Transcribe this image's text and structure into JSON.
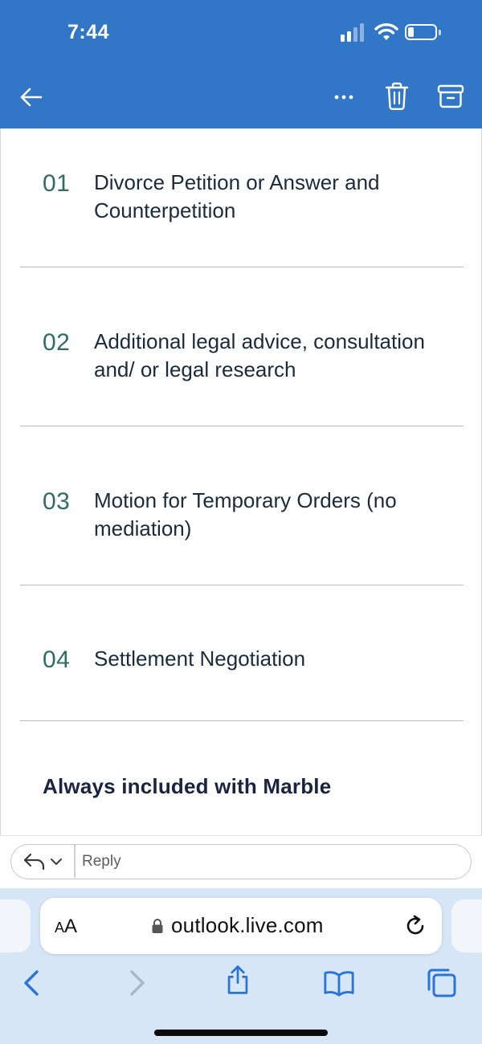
{
  "status_bar": {
    "time": "7:44"
  },
  "toolbar": {
    "back_icon": "back-arrow-icon",
    "more_icon": "more-horizontal-icon",
    "delete_icon": "trash-icon",
    "archive_icon": "archive-icon",
    "header_color": "#3276c8"
  },
  "services": [
    {
      "number": "01",
      "title": "Divorce Petition or Answer and Counterpetition"
    },
    {
      "number": "02",
      "title": "Additional legal advice, consultation and/ or legal research"
    },
    {
      "number": "03",
      "title": "Motion for Temporary Orders (no mediation)"
    },
    {
      "number": "04",
      "title": "Settlement Negotiation"
    }
  ],
  "footer_heading": "Always included with Marble",
  "reply": {
    "placeholder": "Reply"
  },
  "safari": {
    "text_size_label_small": "A",
    "text_size_label_large": "A",
    "url": "outlook.live.com",
    "icons": [
      "back-chevron-icon",
      "forward-chevron-icon",
      "share-icon",
      "bookmarks-icon",
      "tabs-icon"
    ]
  },
  "colors": {
    "accent_green": "#2f6e5c",
    "safari_tint": "#2a73d9"
  }
}
